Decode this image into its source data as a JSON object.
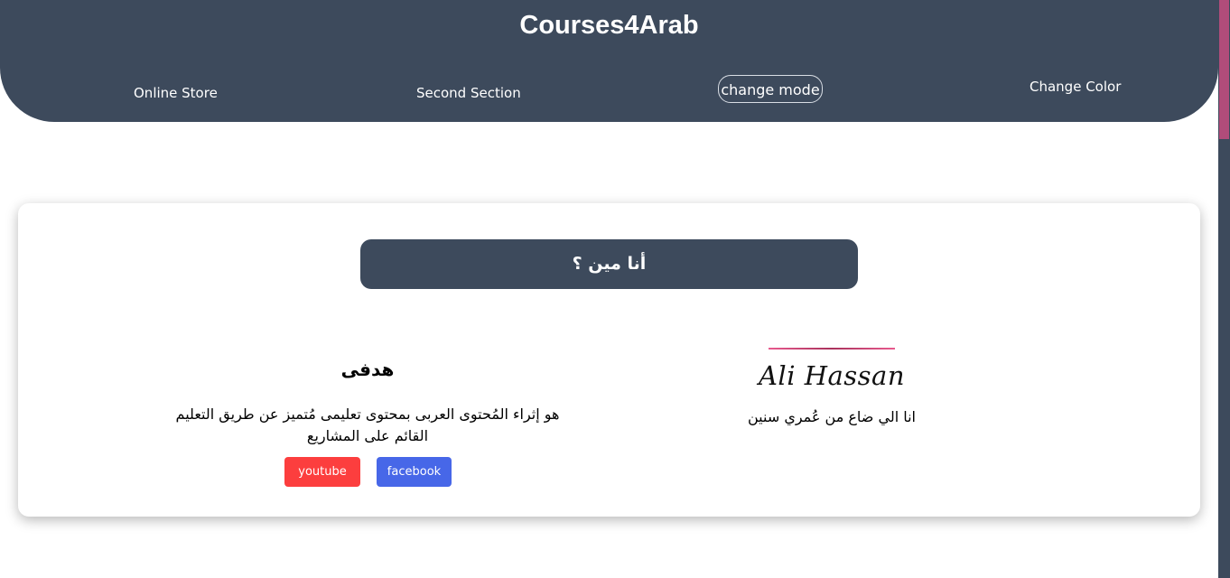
{
  "header": {
    "title": "Courses4Arab",
    "nav": {
      "online_store": "Online Store",
      "second_section": "Second Section",
      "change_mode": "change mode",
      "change_color": "Change Color"
    }
  },
  "about": {
    "heading": "أنا مين ؟",
    "goal_title": "هدفى",
    "goal_text": "هو إثراء المُحتوى العربى بمحتوى تعليمى مُتميز عن طريق التعليم القائم على المشاريع",
    "buttons": {
      "youtube": "youtube",
      "facebook": "facebook"
    },
    "signature": "Ali Hassan",
    "bio": "انا الي ضاع من عُمري سنين"
  },
  "colors": {
    "header_bg": "#3d4a5c",
    "accent": "#b14c7a",
    "youtube": "#fc3e3e",
    "facebook": "#4767e8"
  }
}
